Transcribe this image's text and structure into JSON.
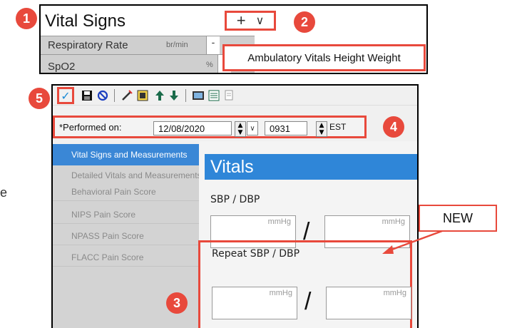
{
  "callouts": {
    "c1": "1",
    "c2": "2",
    "c3": "3",
    "c4": "4",
    "c5": "5"
  },
  "top": {
    "title": "Vital Signs",
    "add_symbol": "+",
    "chevron": "∨",
    "rows": [
      {
        "label": "Respiratory Rate",
        "unit": "br/min",
        "value": "-"
      },
      {
        "label": "SpO2",
        "unit": "%",
        "value": "-"
      }
    ],
    "dropdown_item": "Ambulatory Vitals Height Weight"
  },
  "toolbar": {
    "check": "✓"
  },
  "performed": {
    "label": "*Performed on:",
    "date": "12/08/2020",
    "time": "0931",
    "tz": "EST",
    "dd": "∨"
  },
  "sidebar": {
    "items": [
      {
        "label": "Vital Signs and Measurements"
      },
      {
        "label": "Detailed Vitals and Measurements"
      },
      {
        "label": "Behavioral Pain Score"
      },
      {
        "label": "NIPS Pain Score"
      },
      {
        "label": "NPASS Pain Score"
      },
      {
        "label": "FLACC Pain Score"
      }
    ]
  },
  "form": {
    "header": "Vitals",
    "sbp_label": "SBP / DBP",
    "repeat_label": "Repeat SBP / DBP",
    "unit": "mmHg",
    "slash": "/"
  },
  "new_label": "NEW",
  "left_fragment": "e",
  "colors": {
    "accent": "#e8493c",
    "header_blue": "#2f86d8",
    "active_blue": "#3a87d6"
  }
}
